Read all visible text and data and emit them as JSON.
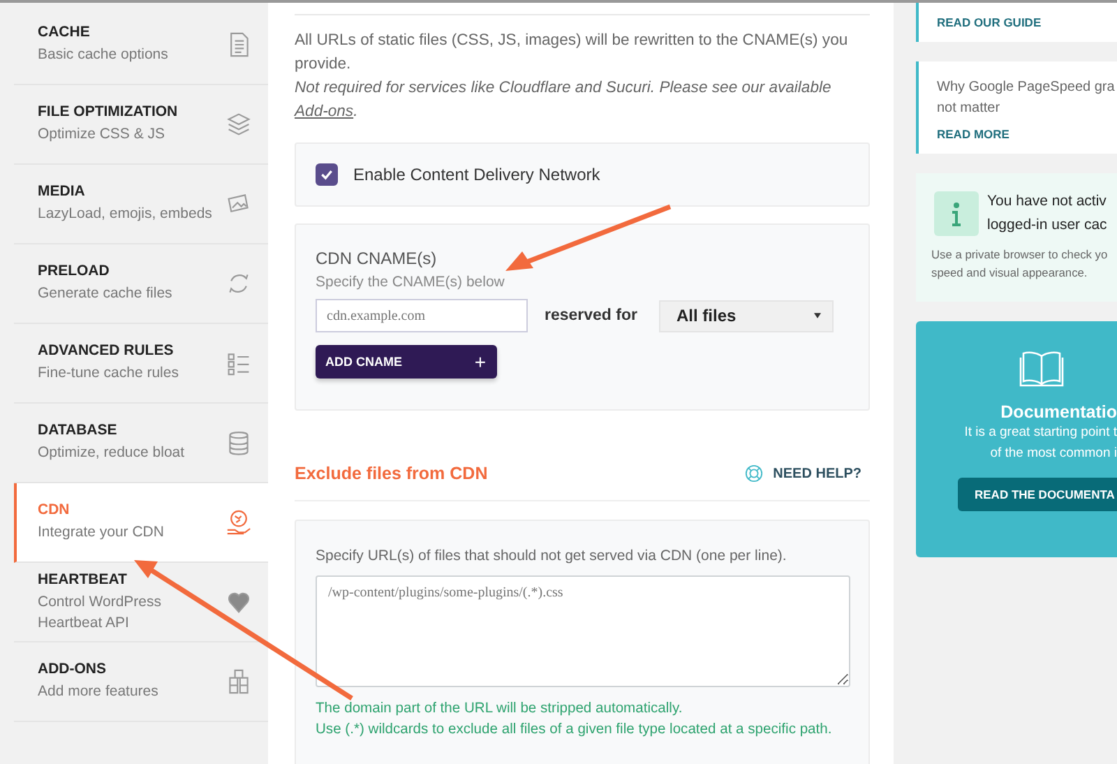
{
  "sidebar": {
    "items": [
      {
        "title": "CACHE",
        "subtitle": "Basic cache options",
        "kind": "document",
        "selected": false
      },
      {
        "title": "FILE OPTIMIZATION",
        "subtitle": "Optimize CSS & JS",
        "kind": "layers",
        "selected": false
      },
      {
        "title": "MEDIA",
        "subtitle": "LazyLoad, emojis, embeds",
        "kind": "images",
        "selected": false
      },
      {
        "title": "PRELOAD",
        "subtitle": "Generate cache files",
        "kind": "refresh",
        "selected": false
      },
      {
        "title": "ADVANCED RULES",
        "subtitle": "Fine-tune cache rules",
        "kind": "list",
        "selected": false
      },
      {
        "title": "DATABASE",
        "subtitle": "Optimize, reduce bloat",
        "kind": "database",
        "selected": false
      },
      {
        "title": "CDN",
        "subtitle": "Integrate your CDN",
        "kind": "globe-hand",
        "selected": true
      },
      {
        "title": "HEARTBEAT",
        "subtitle": "Control WordPress Heartbeat API",
        "kind": "heart",
        "selected": false
      },
      {
        "title": "ADD-ONS",
        "subtitle": "Add more features",
        "kind": "cubes",
        "selected": false
      }
    ]
  },
  "main": {
    "intro": "All URLs of static files (CSS, JS, images) will be rewritten to the CNAME(s) you provide.",
    "note": "Not required for services like Cloudflare and Sucuri. Please see our available",
    "note_link": "Add-ons",
    "note_end": ".",
    "cdn_toggle": {
      "label": "Enable Content Delivery Network",
      "checked": true
    },
    "cname": {
      "title": "CDN CNAME(s)",
      "hint": "Specify the CNAME(s) below",
      "placeholder": "cdn.example.com",
      "reserved_label": "reserved for",
      "select_value": "All files",
      "add_button": "ADD CNAME",
      "add_icon": "+"
    },
    "exclude": {
      "title": "Exclude files from CDN",
      "help": "NEED HELP?",
      "hint": "Specify URL(s) of files that should not get served via CDN (one per line).",
      "placeholder": "/wp-content/plugins/some-plugins/(.*).css",
      "notes": [
        "The domain part of the URL will be stripped automatically.",
        "Use (.*) wildcards to exclude all files of a given file type located at a specific path."
      ]
    }
  },
  "right": {
    "guide_link": "READ OUR GUIDE",
    "article": {
      "lines": [
        "Why Google PageSpeed gra",
        "not matter"
      ],
      "link": "READ MORE"
    },
    "notice": {
      "title_lines": [
        "You have not activ",
        "logged-in user cac"
      ],
      "text_lines": [
        "Use a private browser to check yo",
        "speed and visual appearance."
      ]
    },
    "docs": {
      "title": "Documentatio",
      "lines": [
        "It is a great starting point t",
        "of the most common i"
      ],
      "button": "READ THE DOCUMENTA"
    }
  }
}
